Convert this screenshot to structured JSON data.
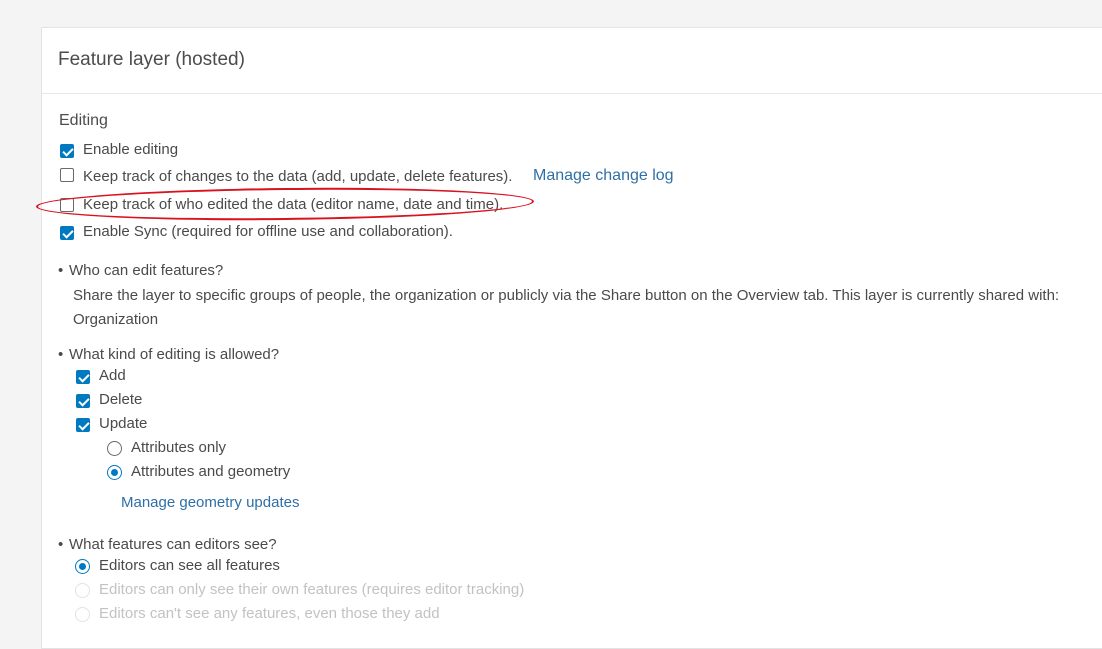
{
  "panel": {
    "title": "Feature layer (hosted)"
  },
  "editing": {
    "label": "Editing",
    "options": [
      {
        "label": "Enable editing",
        "checked": true
      },
      {
        "label": "Keep track of changes to the data (add, update, delete features).",
        "checked": false,
        "link": "Manage change log"
      },
      {
        "label": "Keep track of who edited the data (editor name, date and time).",
        "checked": false
      },
      {
        "label": "Enable Sync (required for offline use and collaboration).",
        "checked": true
      }
    ]
  },
  "who_can_edit": {
    "question": "Who can edit features?",
    "description": "Share the layer to specific groups of people, the organization or publicly via the Share button on the Overview tab. This layer is currently shared with: Organization"
  },
  "editing_kind": {
    "question": "What kind of editing is allowed?",
    "options": [
      {
        "label": "Add",
        "checked": true
      },
      {
        "label": "Delete",
        "checked": true
      },
      {
        "label": "Update",
        "checked": true
      }
    ],
    "update_modes": [
      {
        "label": "Attributes only",
        "selected": false
      },
      {
        "label": "Attributes and geometry",
        "selected": true
      }
    ],
    "link": "Manage geometry updates"
  },
  "features_visible": {
    "question": "What features can editors see?",
    "options": [
      {
        "label": "Editors can see all features",
        "selected": true,
        "disabled": false
      },
      {
        "label": "Editors can only see their own features (requires editor tracking)",
        "selected": false,
        "disabled": true
      },
      {
        "label": "Editors can't see any features, even those they add",
        "selected": false,
        "disabled": true
      }
    ]
  },
  "bullet": "•",
  "colors": {
    "accent": "#0079c1",
    "link": "#2f6fa7",
    "annotation": "#d9121f"
  }
}
